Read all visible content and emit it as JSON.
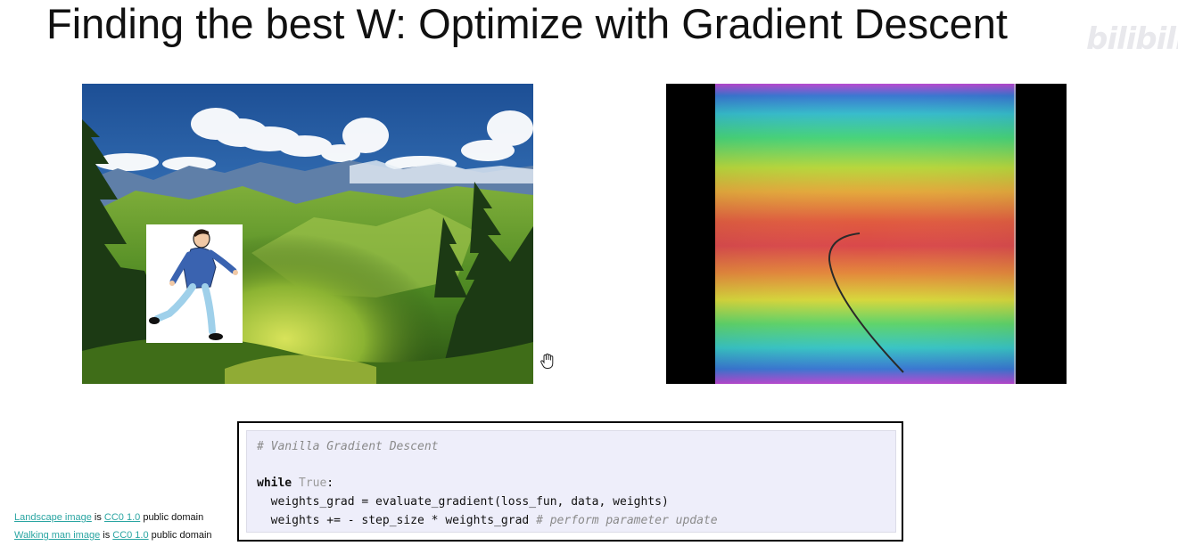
{
  "slide": {
    "title": "Finding the best W: Optimize with Gradient Descent",
    "watermark": "bilibili"
  },
  "images": {
    "landscape": "mountain-landscape-image",
    "walking_man": "walking-man-illustration",
    "loss_surface": "loss-surface-heatmap"
  },
  "code": {
    "comment": "# Vanilla Gradient Descent",
    "while_keyword": "while",
    "while_condition": "True",
    "while_colon": ":",
    "line_grad": "  weights_grad = evaluate_gradient(loss_fun, data, weights)",
    "line_update": "  weights += - step_size * weights_grad",
    "line_update_comment": "# perform parameter update"
  },
  "credits": {
    "landscape_link": "Landscape image",
    "landscape_is": " is ",
    "landscape_license_link": "CC0 1.0",
    "landscape_suffix": " public domain",
    "walker_link": "Walking man image",
    "walker_is": " is ",
    "walker_license_link": "CC0 1.0",
    "walker_suffix": " public domain"
  },
  "colors": {
    "link": "#2aa5a2",
    "code_background": "#eeeefa",
    "frame_border": "#000000"
  },
  "icons": {
    "cursor": "hand-cursor-icon"
  }
}
